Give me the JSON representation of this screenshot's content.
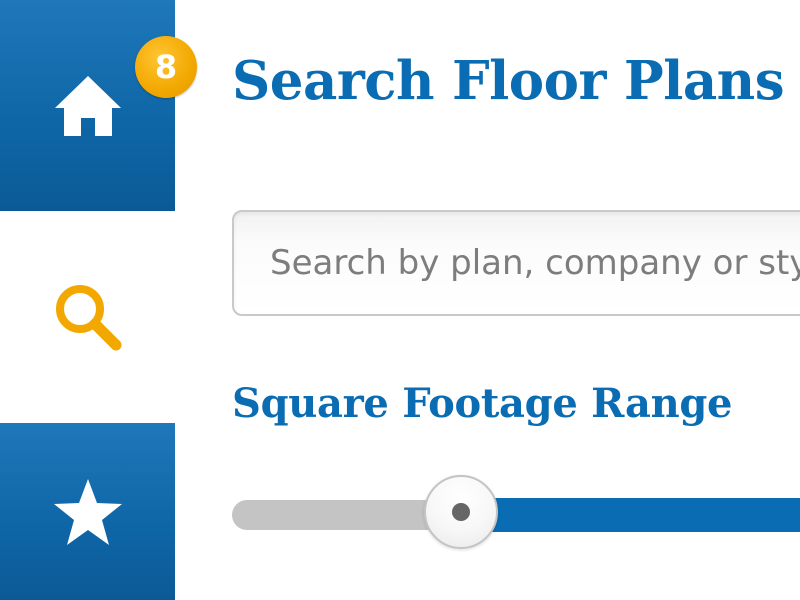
{
  "sidebar": {
    "items": [
      {
        "name": "home",
        "icon": "home-icon",
        "badge": "8",
        "active": true
      },
      {
        "name": "search",
        "icon": "search-icon",
        "active": false
      },
      {
        "name": "favorites",
        "icon": "star-icon",
        "active": true
      }
    ]
  },
  "main": {
    "title": "Search Floor Plans",
    "search": {
      "placeholder": "Search by plan, company or style",
      "value": ""
    },
    "square_footage": {
      "label": "Square Footage Range",
      "slider_position_fraction": 0.4
    }
  },
  "colors": {
    "brand_blue": "#0a6cb3",
    "badge_orange": "#f2a800",
    "search_icon": "#f2a800",
    "track_gray": "#c4c4c4"
  }
}
